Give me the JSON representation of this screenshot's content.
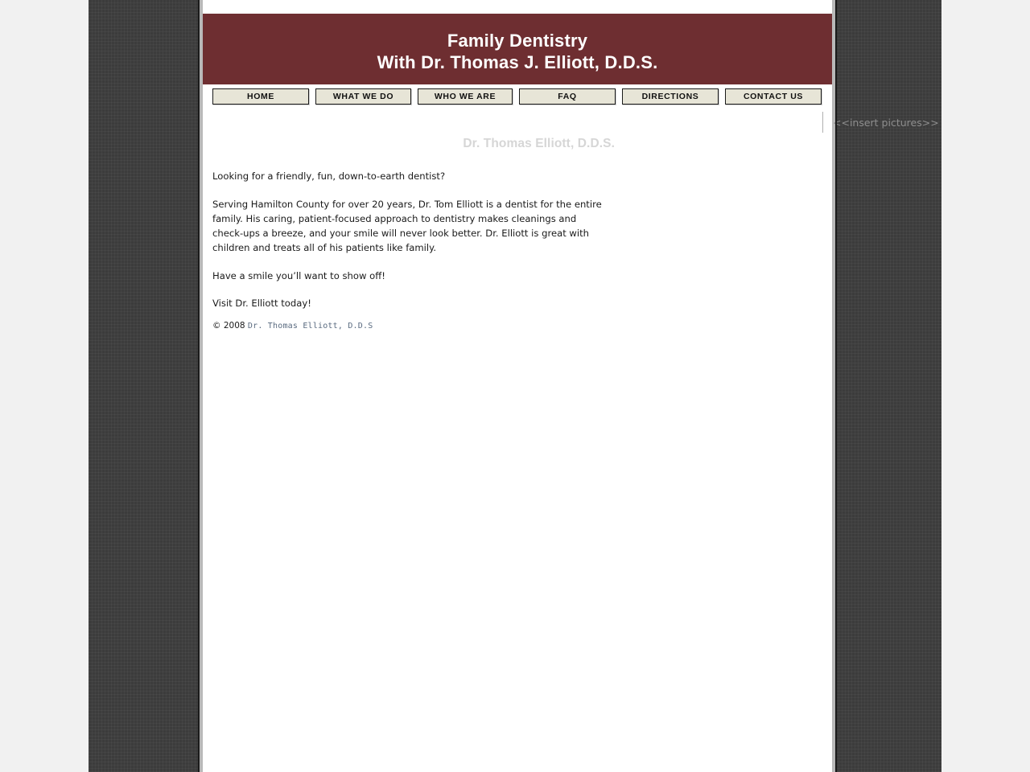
{
  "banner": {
    "line1": "Family Dentistry",
    "line2": "With Dr. Thomas J. Elliott, D.D.S.",
    "background_color": "#6E2E31",
    "text_color": "#FFFFFF"
  },
  "nav": {
    "items": [
      {
        "label": "HOME"
      },
      {
        "label": "WHAT WE DO"
      },
      {
        "label": "WHO WE ARE"
      },
      {
        "label": "FAQ"
      },
      {
        "label": "DIRECTIONS"
      },
      {
        "label": "CONTACT US"
      }
    ],
    "button_color": "#E7E5D7",
    "border_color": "#1A1A1A"
  },
  "pictures": {
    "placeholder": "<<insert pictures>>"
  },
  "main": {
    "heading": "Dr. Thomas Elliott, D.D.S.",
    "heading_color": "#D6D6D6",
    "paragraphs": [
      "Looking for a friendly, fun, down-to-earth dentist?",
      "Serving Hamilton County for over 20 years, Dr. Tom Elliott is a dentist for the entire family. His caring, patient-focused approach to dentistry makes cleanings and check-ups a breeze, and your smile will never look better. Dr. Elliott is great with children and treats all of his patients like family.",
      "Have a smile you’ll want to show off!",
      "Visit Dr. Elliott today!"
    ]
  },
  "footer": {
    "copyright": "© 2008 ",
    "credit": "Dr. Thomas Elliott, D.D.S",
    "credit_color": "#5A6B80"
  },
  "theme": {
    "page_background": "#FFFFFF",
    "backdrop_color": "#3C3C3C",
    "frame_color": "#B9B9B9",
    "outer_color": "#F1F1F1"
  }
}
